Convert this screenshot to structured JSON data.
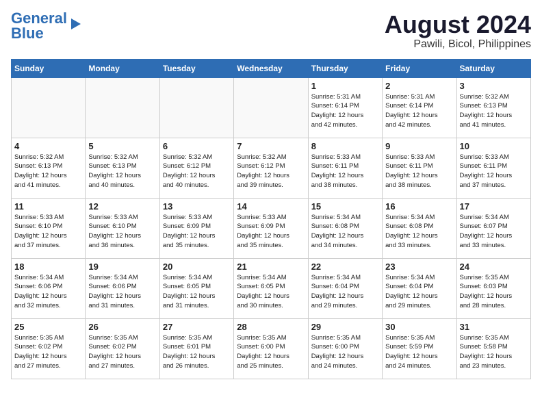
{
  "header": {
    "logo_line1": "General",
    "logo_line2": "Blue",
    "month_year": "August 2024",
    "location": "Pawili, Bicol, Philippines"
  },
  "days_of_week": [
    "Sunday",
    "Monday",
    "Tuesday",
    "Wednesday",
    "Thursday",
    "Friday",
    "Saturday"
  ],
  "weeks": [
    [
      {
        "day": "",
        "info": "",
        "empty": true
      },
      {
        "day": "",
        "info": "",
        "empty": true
      },
      {
        "day": "",
        "info": "",
        "empty": true
      },
      {
        "day": "",
        "info": "",
        "empty": true
      },
      {
        "day": "1",
        "info": "Sunrise: 5:31 AM\nSunset: 6:14 PM\nDaylight: 12 hours\nand 42 minutes."
      },
      {
        "day": "2",
        "info": "Sunrise: 5:31 AM\nSunset: 6:14 PM\nDaylight: 12 hours\nand 42 minutes."
      },
      {
        "day": "3",
        "info": "Sunrise: 5:32 AM\nSunset: 6:13 PM\nDaylight: 12 hours\nand 41 minutes."
      }
    ],
    [
      {
        "day": "4",
        "info": "Sunrise: 5:32 AM\nSunset: 6:13 PM\nDaylight: 12 hours\nand 41 minutes."
      },
      {
        "day": "5",
        "info": "Sunrise: 5:32 AM\nSunset: 6:13 PM\nDaylight: 12 hours\nand 40 minutes."
      },
      {
        "day": "6",
        "info": "Sunrise: 5:32 AM\nSunset: 6:12 PM\nDaylight: 12 hours\nand 40 minutes."
      },
      {
        "day": "7",
        "info": "Sunrise: 5:32 AM\nSunset: 6:12 PM\nDaylight: 12 hours\nand 39 minutes."
      },
      {
        "day": "8",
        "info": "Sunrise: 5:33 AM\nSunset: 6:11 PM\nDaylight: 12 hours\nand 38 minutes."
      },
      {
        "day": "9",
        "info": "Sunrise: 5:33 AM\nSunset: 6:11 PM\nDaylight: 12 hours\nand 38 minutes."
      },
      {
        "day": "10",
        "info": "Sunrise: 5:33 AM\nSunset: 6:11 PM\nDaylight: 12 hours\nand 37 minutes."
      }
    ],
    [
      {
        "day": "11",
        "info": "Sunrise: 5:33 AM\nSunset: 6:10 PM\nDaylight: 12 hours\nand 37 minutes."
      },
      {
        "day": "12",
        "info": "Sunrise: 5:33 AM\nSunset: 6:10 PM\nDaylight: 12 hours\nand 36 minutes."
      },
      {
        "day": "13",
        "info": "Sunrise: 5:33 AM\nSunset: 6:09 PM\nDaylight: 12 hours\nand 35 minutes."
      },
      {
        "day": "14",
        "info": "Sunrise: 5:33 AM\nSunset: 6:09 PM\nDaylight: 12 hours\nand 35 minutes."
      },
      {
        "day": "15",
        "info": "Sunrise: 5:34 AM\nSunset: 6:08 PM\nDaylight: 12 hours\nand 34 minutes."
      },
      {
        "day": "16",
        "info": "Sunrise: 5:34 AM\nSunset: 6:08 PM\nDaylight: 12 hours\nand 33 minutes."
      },
      {
        "day": "17",
        "info": "Sunrise: 5:34 AM\nSunset: 6:07 PM\nDaylight: 12 hours\nand 33 minutes."
      }
    ],
    [
      {
        "day": "18",
        "info": "Sunrise: 5:34 AM\nSunset: 6:06 PM\nDaylight: 12 hours\nand 32 minutes."
      },
      {
        "day": "19",
        "info": "Sunrise: 5:34 AM\nSunset: 6:06 PM\nDaylight: 12 hours\nand 31 minutes."
      },
      {
        "day": "20",
        "info": "Sunrise: 5:34 AM\nSunset: 6:05 PM\nDaylight: 12 hours\nand 31 minutes."
      },
      {
        "day": "21",
        "info": "Sunrise: 5:34 AM\nSunset: 6:05 PM\nDaylight: 12 hours\nand 30 minutes."
      },
      {
        "day": "22",
        "info": "Sunrise: 5:34 AM\nSunset: 6:04 PM\nDaylight: 12 hours\nand 29 minutes."
      },
      {
        "day": "23",
        "info": "Sunrise: 5:34 AM\nSunset: 6:04 PM\nDaylight: 12 hours\nand 29 minutes."
      },
      {
        "day": "24",
        "info": "Sunrise: 5:35 AM\nSunset: 6:03 PM\nDaylight: 12 hours\nand 28 minutes."
      }
    ],
    [
      {
        "day": "25",
        "info": "Sunrise: 5:35 AM\nSunset: 6:02 PM\nDaylight: 12 hours\nand 27 minutes."
      },
      {
        "day": "26",
        "info": "Sunrise: 5:35 AM\nSunset: 6:02 PM\nDaylight: 12 hours\nand 27 minutes."
      },
      {
        "day": "27",
        "info": "Sunrise: 5:35 AM\nSunset: 6:01 PM\nDaylight: 12 hours\nand 26 minutes."
      },
      {
        "day": "28",
        "info": "Sunrise: 5:35 AM\nSunset: 6:00 PM\nDaylight: 12 hours\nand 25 minutes."
      },
      {
        "day": "29",
        "info": "Sunrise: 5:35 AM\nSunset: 6:00 PM\nDaylight: 12 hours\nand 24 minutes."
      },
      {
        "day": "30",
        "info": "Sunrise: 5:35 AM\nSunset: 5:59 PM\nDaylight: 12 hours\nand 24 minutes."
      },
      {
        "day": "31",
        "info": "Sunrise: 5:35 AM\nSunset: 5:58 PM\nDaylight: 12 hours\nand 23 minutes."
      }
    ]
  ]
}
